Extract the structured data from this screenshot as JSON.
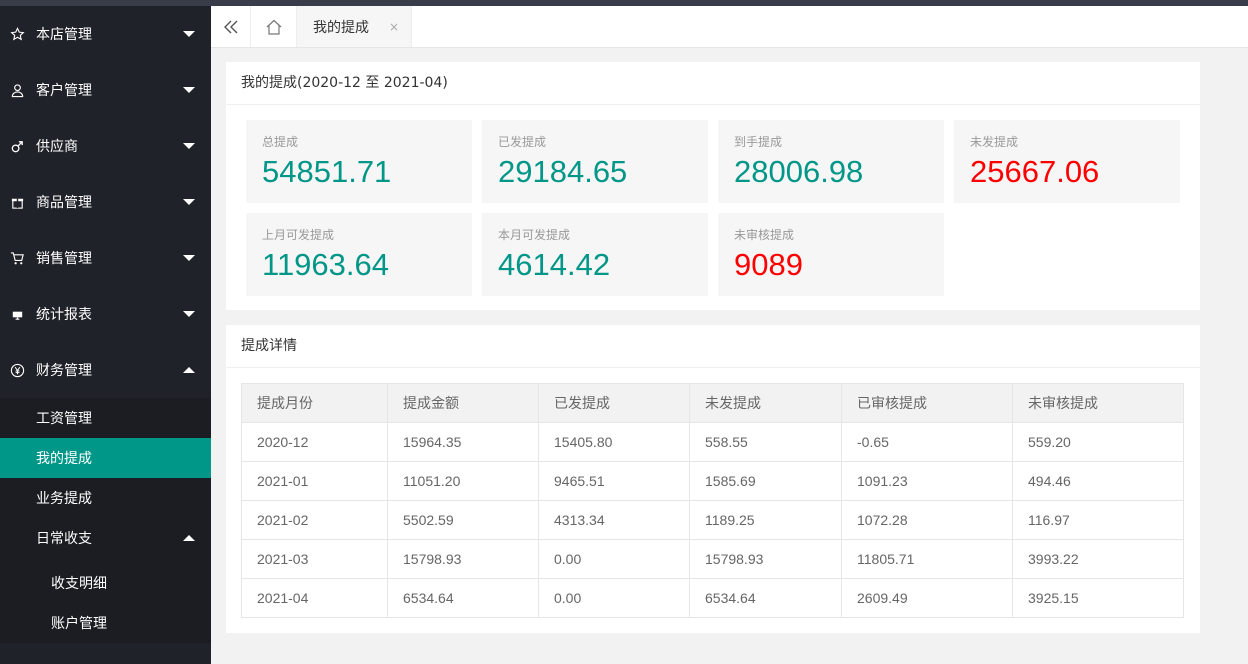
{
  "sidebar": {
    "items": [
      {
        "label": "本店管理",
        "icon": "star-icon"
      },
      {
        "label": "客户管理",
        "icon": "user-icon"
      },
      {
        "label": "供应商",
        "icon": "male-icon"
      },
      {
        "label": "商品管理",
        "icon": "gift-icon"
      },
      {
        "label": "销售管理",
        "icon": "cart-icon"
      },
      {
        "label": "统计报表",
        "icon": "monitor-icon"
      },
      {
        "label": "财务管理",
        "icon": "yen-icon"
      }
    ],
    "finance_sub": [
      "工资管理",
      "我的提成",
      "业务提成",
      "日常收支"
    ],
    "daily_sub": [
      "收支明细",
      "账户管理"
    ]
  },
  "topbar": {
    "tab_label": "我的提成",
    "close_symbol": "×"
  },
  "summary": {
    "title": "我的提成(2020-12 至 2021-04)",
    "stats": [
      {
        "label": "总提成",
        "value": "54851.71",
        "color": "#009688"
      },
      {
        "label": "已发提成",
        "value": "29184.65",
        "color": "#009688"
      },
      {
        "label": "到手提成",
        "value": "28006.98",
        "color": "#009688"
      },
      {
        "label": "未发提成",
        "value": "25667.06",
        "color": "#ff0000"
      },
      {
        "label": "上月可发提成",
        "value": "11963.64",
        "color": "#009688"
      },
      {
        "label": "本月可发提成",
        "value": "4614.42",
        "color": "#009688"
      },
      {
        "label": "未审核提成",
        "value": "9089",
        "color": "#ff0000"
      }
    ]
  },
  "details": {
    "title": "提成详情",
    "columns": [
      "提成月份",
      "提成金额",
      "已发提成",
      "未发提成",
      "已审核提成",
      "未审核提成"
    ],
    "rows": [
      [
        "2020-12",
        "15964.35",
        "15405.80",
        "558.55",
        "-0.65",
        "559.20"
      ],
      [
        "2021-01",
        "11051.20",
        "9465.51",
        "1585.69",
        "1091.23",
        "494.46"
      ],
      [
        "2021-02",
        "5502.59",
        "4313.34",
        "1189.25",
        "1072.28",
        "116.97"
      ],
      [
        "2021-03",
        "15798.93",
        "0.00",
        "15798.93",
        "11805.71",
        "3993.22"
      ],
      [
        "2021-04",
        "6534.64",
        "0.00",
        "6534.64",
        "2609.49",
        "3925.15"
      ]
    ]
  },
  "colors": {
    "accent": "#009688",
    "danger": "#ff0000",
    "sidebar": "#20222a"
  }
}
